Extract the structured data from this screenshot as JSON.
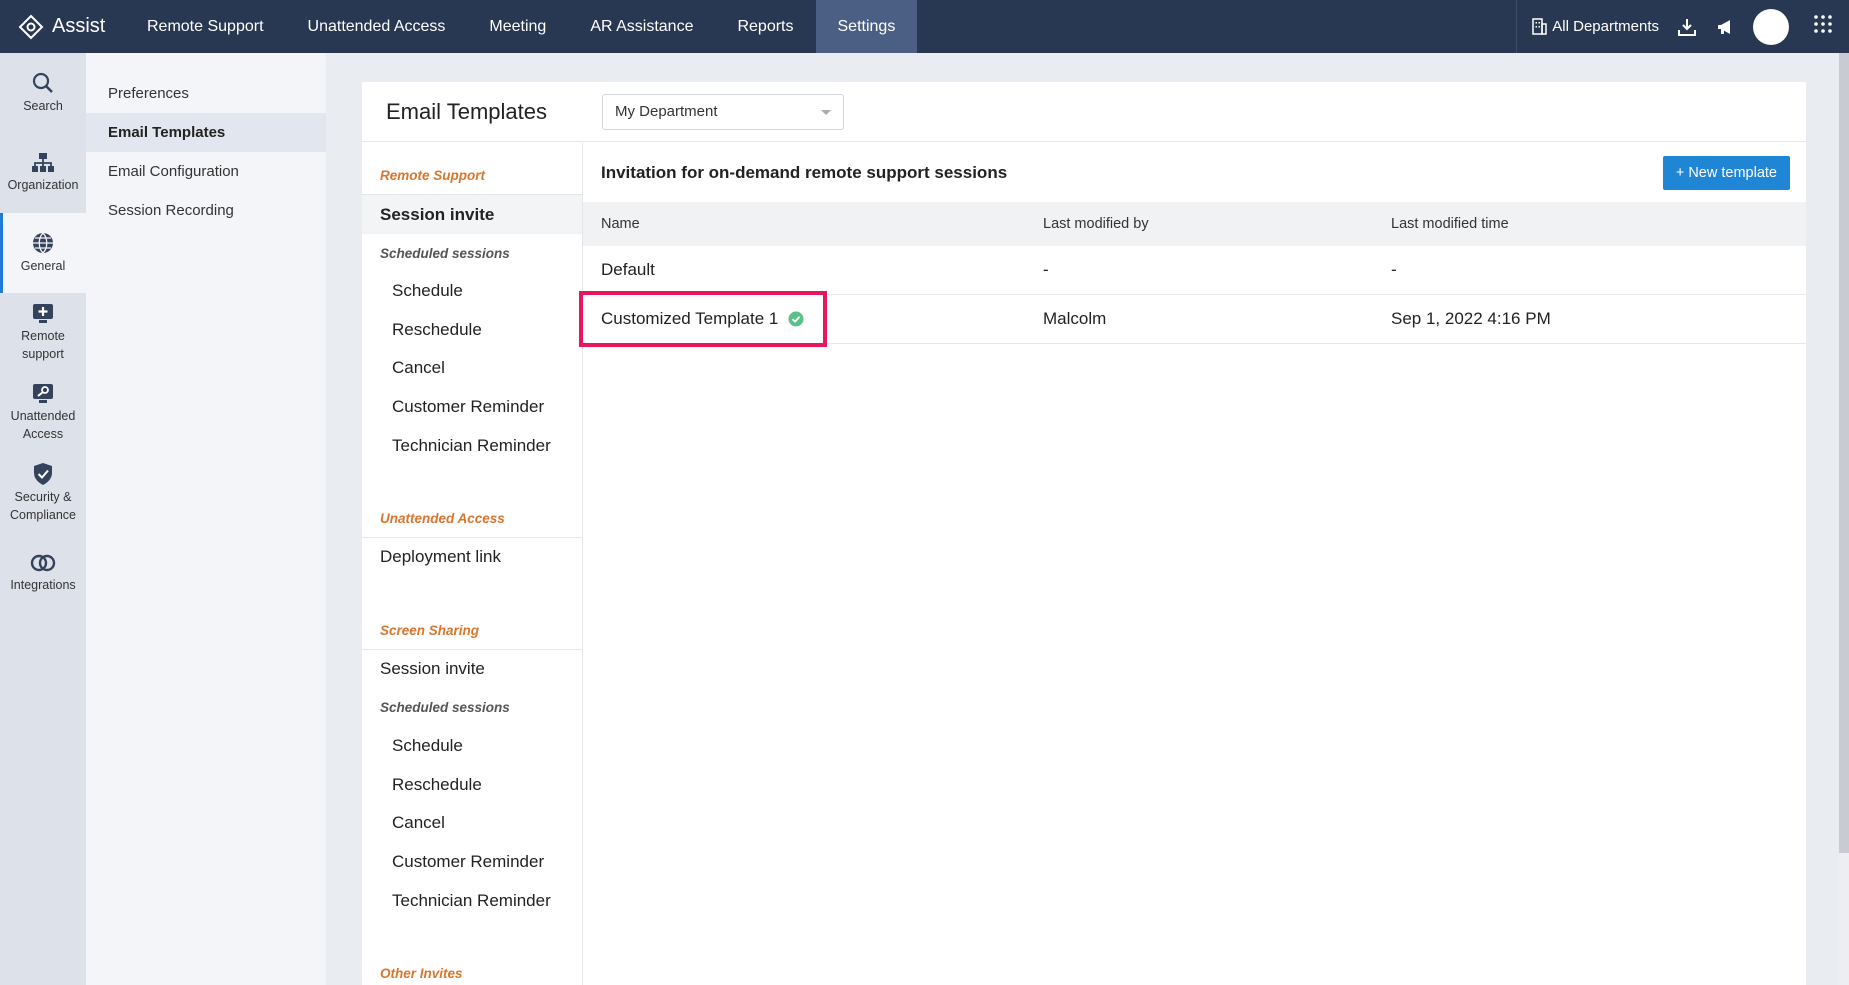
{
  "app": {
    "name": "Assist"
  },
  "nav": [
    {
      "label": "Remote Support"
    },
    {
      "label": "Unattended Access"
    },
    {
      "label": "Meeting"
    },
    {
      "label": "AR Assistance"
    },
    {
      "label": "Reports"
    },
    {
      "label": "Settings",
      "active": true
    }
  ],
  "topright": {
    "departments": "All Departments"
  },
  "rail": [
    {
      "label": "Search",
      "icon": "search-icon"
    },
    {
      "label": "Organization",
      "icon": "organization-icon"
    },
    {
      "label": "General",
      "icon": "globe-icon",
      "active": true
    },
    {
      "label": "Remote support",
      "icon": "remote-support-icon"
    },
    {
      "label": "Unattended Access",
      "icon": "unattended-access-icon"
    },
    {
      "label": "Security & Compliance",
      "icon": "shield-icon"
    },
    {
      "label": "Integrations",
      "icon": "integrations-icon"
    }
  ],
  "subnav": [
    {
      "label": "Preferences"
    },
    {
      "label": "Email Templates",
      "active": true
    },
    {
      "label": "Email Configuration"
    },
    {
      "label": "Session Recording"
    }
  ],
  "panel": {
    "title": "Email Templates",
    "department_select": "My Department"
  },
  "templates_nav": {
    "remote_support": {
      "section": "Remote Support",
      "session_invite": "Session invite",
      "scheduled": "Scheduled sessions",
      "items": [
        "Schedule",
        "Reschedule",
        "Cancel",
        "Customer Reminder",
        "Technician Reminder"
      ]
    },
    "unattended": {
      "section": "Unattended Access",
      "deployment": "Deployment link"
    },
    "screen_sharing": {
      "section": "Screen Sharing",
      "session_invite": "Session invite",
      "scheduled": "Scheduled sessions",
      "items": [
        "Schedule",
        "Reschedule",
        "Cancel",
        "Customer Reminder",
        "Technician Reminder"
      ]
    },
    "other": {
      "section": "Other Invites"
    }
  },
  "content": {
    "title": "Invitation for on-demand remote support sessions",
    "new_button": "+ New template",
    "columns": [
      "Name",
      "Last modified by",
      "Last modified time"
    ],
    "rows": [
      {
        "name": "Default",
        "by": "-",
        "time": "-"
      },
      {
        "name": "Customized Template 1",
        "by": "Malcolm",
        "time": "Sep 1, 2022 4:16 PM",
        "active": true
      }
    ]
  },
  "colors": {
    "topbar": "#283752",
    "accent": "#1f86d6",
    "section": "#d8762e",
    "highlight": "#e8175d",
    "check": "#5cc08a"
  }
}
